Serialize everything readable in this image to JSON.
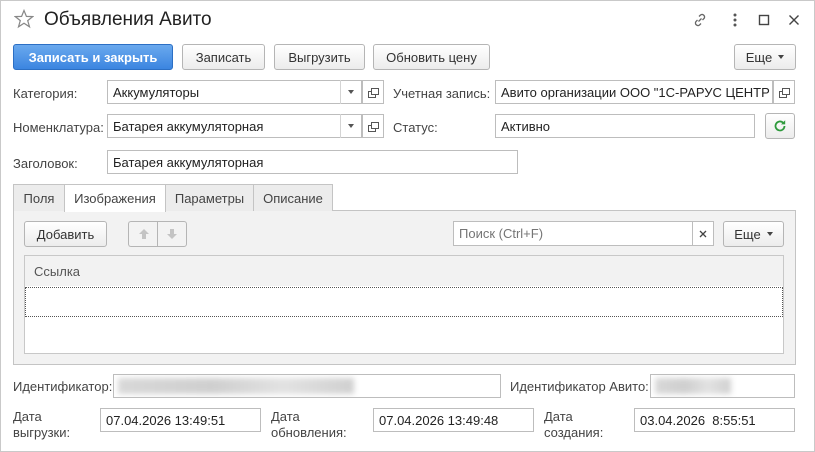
{
  "window": {
    "title": "Объявления Авито",
    "icons": [
      "star-icon",
      "link-icon",
      "more-vertical-icon",
      "maximize-icon",
      "close-icon"
    ]
  },
  "toolbar": {
    "save_close": "Записать и закрыть",
    "save": "Записать",
    "export": "Выгрузить",
    "update_price": "Обновить цену",
    "more": "Еще"
  },
  "form": {
    "category_label": "Категория:",
    "category_value": "Аккумуляторы",
    "account_label": "Учетная запись:",
    "account_value": "Авито организации ООО \"1С-РАРУС ЦЕНТР",
    "nomenclature_label": "Номенклатура:",
    "nomenclature_value": "Батарея аккумуляторная",
    "status_label": "Статус:",
    "status_value": "Активно",
    "heading_label": "Заголовок:",
    "heading_value": "Батарея аккумуляторная"
  },
  "tabs": [
    {
      "label": "Поля"
    },
    {
      "label": "Изображения"
    },
    {
      "label": "Параметры"
    },
    {
      "label": "Описание"
    }
  ],
  "images_panel": {
    "add_button": "Добавить",
    "search_placeholder": "Поиск (Ctrl+F)",
    "more": "Еще",
    "column_link": "Ссылка"
  },
  "footer": {
    "identifier_label": "Идентификатор:",
    "avito_identifier_label": "Идентификатор Авито:",
    "export_date_label_1": "Дата",
    "export_date_label_2": "выгрузки:",
    "export_date_value": "07.04.2026 13:49:51",
    "update_date_label_1": "Дата",
    "update_date_label_2": "обновления:",
    "update_date_value": "07.04.2026 13:49:48",
    "create_date_label_1": "Дата",
    "create_date_label_2": "создания:",
    "create_date_value": "03.04.2026  8:55:51"
  },
  "colors": {
    "primary_button": "#3b85e0",
    "refresh_icon": "#2e9a3c"
  }
}
